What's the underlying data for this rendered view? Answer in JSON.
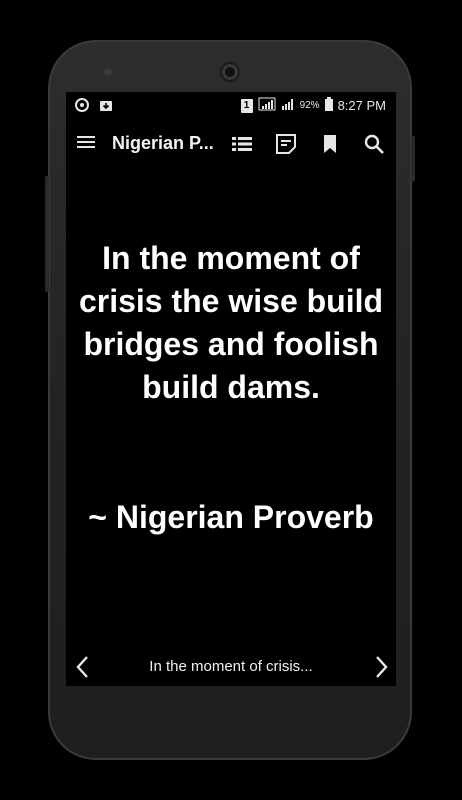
{
  "status_bar": {
    "sim_label": "1",
    "battery_percent": "92%",
    "time": "8:27 PM"
  },
  "toolbar": {
    "title": "Nigerian P..."
  },
  "quote": {
    "text": "In the moment of crisis the wise build bridges and foolish build dams.",
    "attribution": "~ Nigerian Proverb"
  },
  "bottom_nav": {
    "caption": "In the moment of crisis..."
  },
  "icons": {
    "status_left": [
      "sync-icon",
      "download-icon"
    ],
    "status_right": [
      "sim-icon",
      "signal-icon",
      "signal-icon",
      "battery-icon"
    ],
    "toolbar": [
      "menu-icon",
      "list-icon",
      "note-icon",
      "bookmark-icon",
      "search-icon"
    ],
    "nav": [
      "chevron-left-icon",
      "chevron-right-icon"
    ]
  },
  "colors": {
    "background": "#000000",
    "text": "#ffffff",
    "phone_body": "#262626"
  }
}
